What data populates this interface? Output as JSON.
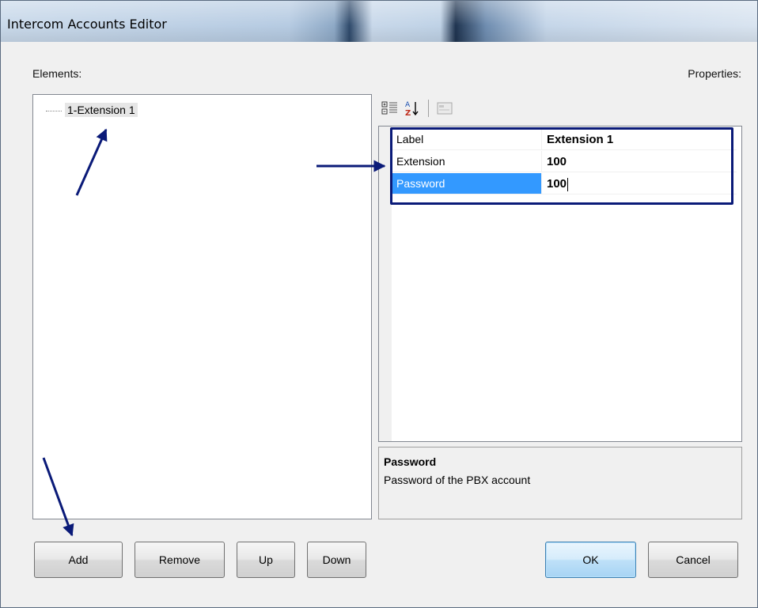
{
  "window": {
    "title": "Intercom Accounts Editor"
  },
  "labels": {
    "elements": "Elements:",
    "properties": "Properties:"
  },
  "tree": {
    "items": [
      {
        "label": "1-Extension 1"
      }
    ]
  },
  "toolbar": {
    "icons": [
      "categorized-icon",
      "alphabetical-sort-icon",
      "property-pages-icon"
    ]
  },
  "property_grid": {
    "rows": [
      {
        "key": "Label",
        "value": "Extension 1"
      },
      {
        "key": "Extension",
        "value": "100"
      },
      {
        "key": "Password",
        "value": "100"
      }
    ],
    "selected_key": "Password"
  },
  "description": {
    "title": "Password",
    "text": "Password of the PBX account"
  },
  "buttons": {
    "add": "Add",
    "remove": "Remove",
    "up": "Up",
    "down": "Down",
    "ok": "OK",
    "cancel": "Cancel"
  },
  "colors": {
    "selection": "#3399ff",
    "annotation": "#0a1a78"
  }
}
